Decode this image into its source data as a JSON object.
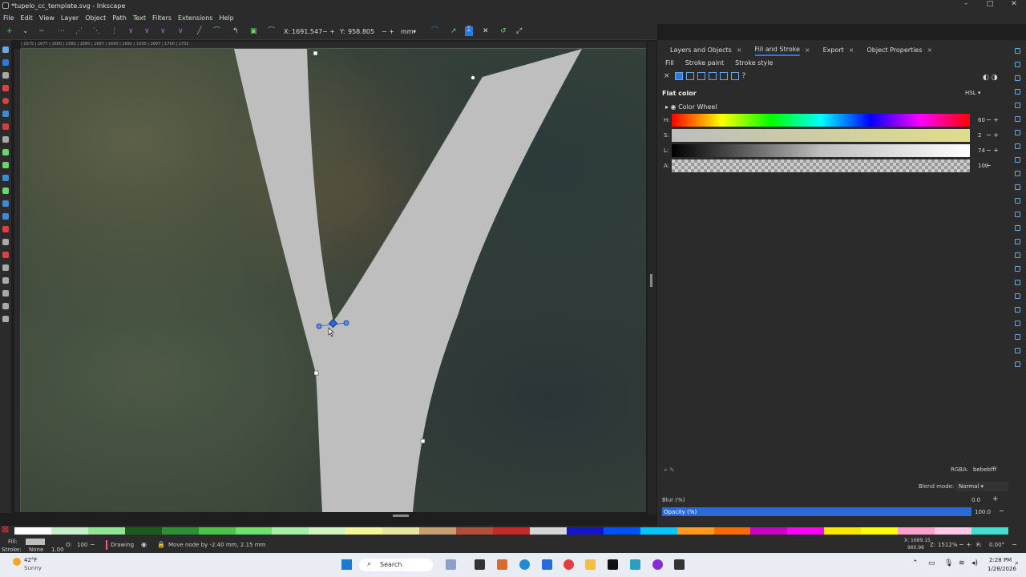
{
  "window": {
    "title": "*tupelo_cc_template.svg - Inkscape",
    "controls": [
      "–",
      "□",
      "✕"
    ]
  },
  "menu": [
    "File",
    "Edit",
    "View",
    "Layer",
    "Object",
    "Path",
    "Text",
    "Filters",
    "Extensions",
    "Help"
  ],
  "coords": {
    "x_label": "X:",
    "x_value": "1691.547",
    "y_label": "Y:",
    "y_value": "958.805",
    "unit": "mm"
  },
  "ruler_text": "| 1675 | 1677 | 1680 | 1682 | 1685 | 1687 | 1690 | 1692 | 1695 | 1697 | 1700 | 1702",
  "panel": {
    "tabs": [
      "Layers and Objects",
      "Fill and Stroke",
      "Export",
      "Object Properties"
    ],
    "active_tab": "Fill and Stroke",
    "subtabs": [
      "Fill",
      "Stroke paint",
      "Stroke style"
    ],
    "paint_type": "Flat color",
    "color_mode": "HSL",
    "color_wheel_label": "Color Wheel",
    "sliders": [
      {
        "label": "H:",
        "value": "60"
      },
      {
        "label": "S:",
        "value": "2"
      },
      {
        "label": "L:",
        "value": "74"
      },
      {
        "label": "A:",
        "value": "100"
      }
    ],
    "rgba_label": "RGBA:",
    "rgba_value": "bebebfff",
    "blend_label": "Blend mode:",
    "blend_value": "Normal",
    "blur_label": "Blur (%)",
    "blur_value": "0.0",
    "opacity_label": "Opacity (%)",
    "opacity_value": "100.0",
    "opacity_level": 1.0
  },
  "status": {
    "fill_label": "Fill:",
    "stroke_label": "Stroke:",
    "stroke_value": "None",
    "stroke_width": "1.00",
    "opacity_label": "O:",
    "opacity_value": "100",
    "layer": "Drawing",
    "message": "Move node by -2.40 mm, 2.15 mm",
    "cursor_x": "X: 1689.15",
    "cursor_y": "960.96",
    "zoom_label": "Z:",
    "zoom_value": "1512%",
    "rotate_label": "R:",
    "rotate_value": "0.00°"
  },
  "fill_color": "#bebebf",
  "palette": [
    "#ffffff",
    "#c8f0c8",
    "#90e690",
    "#1a5a1a",
    "#2f8f2f",
    "#4cc24c",
    "#6fe06f",
    "#a6f0a6",
    "#d0f5c0",
    "#f5f59a",
    "#e6e6a0",
    "#c8a06e",
    "#b0503a",
    "#c82828",
    "#d6d6d6",
    "#1414c8",
    "#0050ff",
    "#00c8ff",
    "#ff9a1a",
    "#ff6a00",
    "#c800c8",
    "#ff00ff",
    "#ffe600",
    "#ffff00",
    "#ffa0d0",
    "#ffc8e6",
    "#40e0d0"
  ],
  "taskbar": {
    "weather_temp": "42°F",
    "weather_desc": "Sunny",
    "search": "Search",
    "time": "2:28 PM",
    "date": "1/28/2026"
  }
}
